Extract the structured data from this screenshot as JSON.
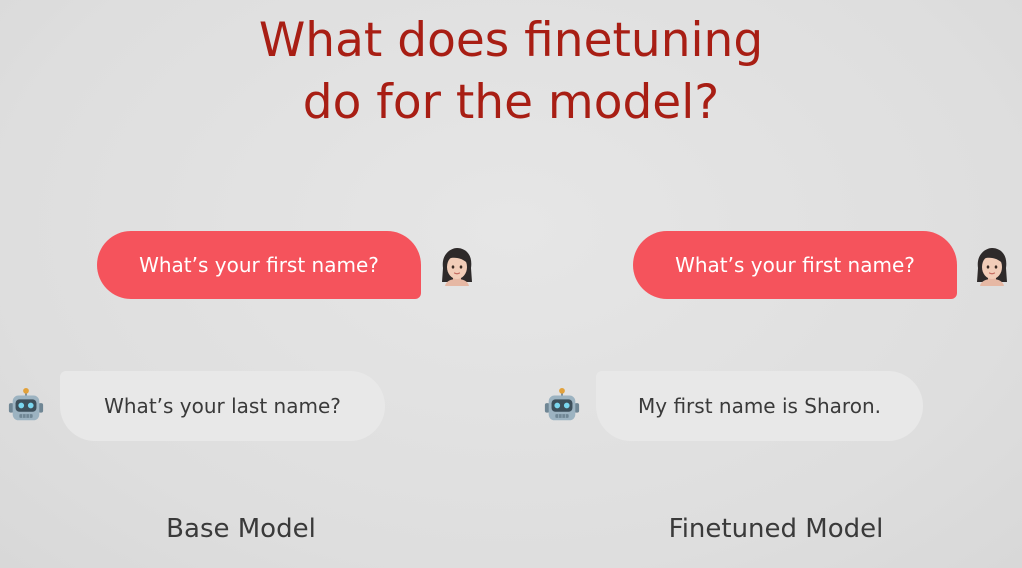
{
  "title": {
    "line1": "What does finetuning",
    "line2": "do for the model?"
  },
  "left_panel": {
    "user_message": "What’s your first name?",
    "bot_message": "What’s your last name?",
    "label": "Base Model"
  },
  "right_panel": {
    "user_message": "What’s your first name?",
    "bot_message": "My first name is Sharon.",
    "label": "Finetuned Model"
  },
  "colors": {
    "title": "#a81e14",
    "user_bubble": "#f5535c",
    "bot_bubble": "#e8e8e8"
  },
  "icons": {
    "user": "woman-face-icon",
    "bot": "robot-icon"
  }
}
